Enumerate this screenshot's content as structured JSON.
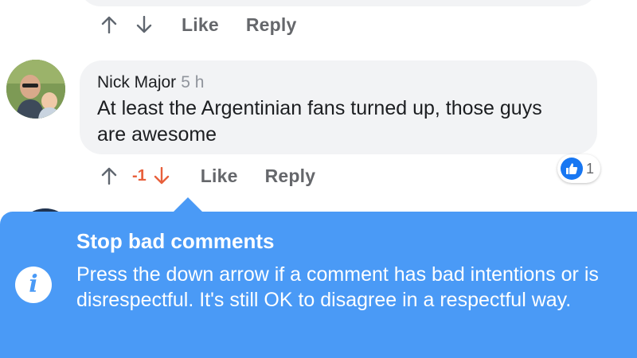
{
  "previous_comment": {
    "actions": {
      "like_label": "Like",
      "reply_label": "Reply"
    },
    "icons": [
      "arrow-up-icon",
      "arrow-down-icon"
    ]
  },
  "comment": {
    "author": "Nick Major",
    "timestamp": "5 h",
    "text": "At least the Argentinian fans turned up, those guys are awesome",
    "vote_score": "-1",
    "reaction_count": "1",
    "actions": {
      "like_label": "Like",
      "reply_label": "Reply"
    },
    "icons": [
      "arrow-up-icon",
      "arrow-down-icon",
      "thumbs-up-icon"
    ]
  },
  "tooltip": {
    "title": "Stop bad comments",
    "body": "Press the down arrow if a comment has bad intentions or is disrespectful. It's still OK to disagree in a respectful way.",
    "icon": "info-icon"
  },
  "colors": {
    "tooltip_background": "#4a9af6",
    "downvote_active": "#e8603c",
    "bubble_background": "#f2f3f5",
    "like_badge": "#1877f2",
    "action_text": "#65676b"
  }
}
